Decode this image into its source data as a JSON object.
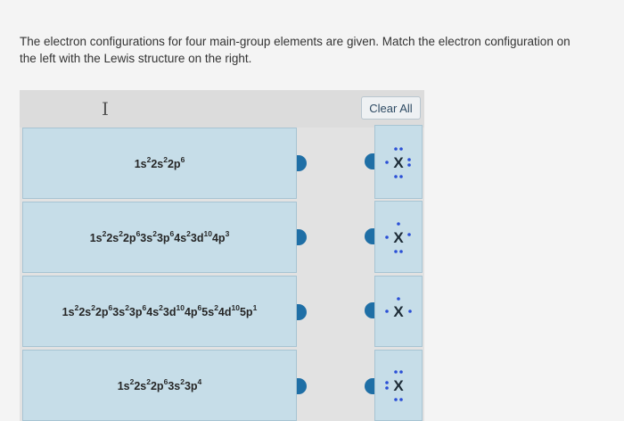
{
  "prompt": {
    "text": "The electron configurations for four main-group elements are given. Match the electron configuration on the left with the Lewis structure on the right."
  },
  "toolbar": {
    "clear_all_label": "Clear All",
    "cursor_icon": "text-cursor-icon"
  },
  "configurations": [
    {
      "parts": [
        [
          "1s",
          "2"
        ],
        [
          "2s",
          "2"
        ],
        [
          "2p",
          "6"
        ]
      ]
    },
    {
      "parts": [
        [
          "1s",
          "2"
        ],
        [
          "2s",
          "2"
        ],
        [
          "2p",
          "6"
        ],
        [
          "3s",
          "2"
        ],
        [
          "3p",
          "6"
        ],
        [
          "4s",
          "2"
        ],
        [
          "3d",
          "10"
        ],
        [
          "4p",
          "3"
        ]
      ]
    },
    {
      "parts": [
        [
          "1s",
          "2"
        ],
        [
          "2s",
          "2"
        ],
        [
          "2p",
          "6"
        ],
        [
          "3s",
          "2"
        ],
        [
          "3p",
          "6"
        ],
        [
          "4s",
          "2"
        ],
        [
          "3d",
          "10"
        ],
        [
          "4p",
          "6"
        ],
        [
          "5s",
          "2"
        ],
        [
          "4d",
          "10"
        ],
        [
          "5p",
          "1"
        ]
      ]
    },
    {
      "parts": [
        [
          "1s",
          "2"
        ],
        [
          "2s",
          "2"
        ],
        [
          "2p",
          "6"
        ],
        [
          "3s",
          "2"
        ],
        [
          "3p",
          "4"
        ]
      ]
    }
  ],
  "lewis_structures": [
    {
      "symbol": "X",
      "valence_electrons": 7
    },
    {
      "symbol": "X",
      "valence_electrons": 5
    },
    {
      "symbol": "X",
      "valence_electrons": 3
    },
    {
      "symbol": "X",
      "valence_electrons": 6
    }
  ],
  "colors": {
    "card": "#c6dde8",
    "connector": "#1f6fa6",
    "dot": "#2a4fd6"
  }
}
